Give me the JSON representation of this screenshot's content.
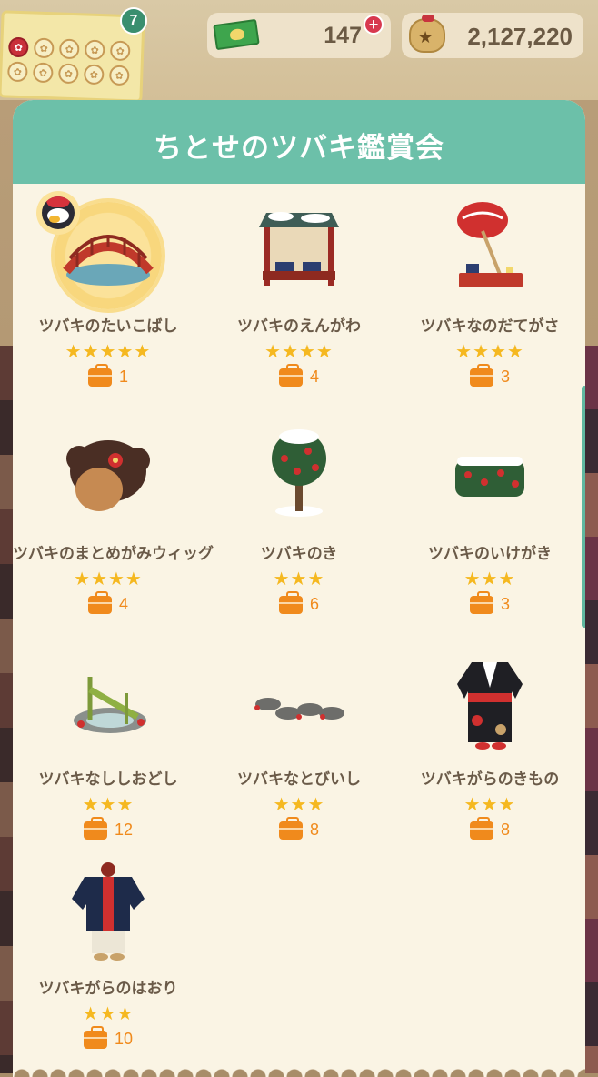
{
  "hud": {
    "stamp_badge": "7",
    "tickets": "147",
    "bells": "2,127,220"
  },
  "modal": {
    "title": "ちとせのツバキ鑑賞会"
  },
  "items": [
    {
      "name": "ツバキのたいこばし",
      "stars": "★★★★★",
      "count": "1",
      "icon": "drum-bridge-icon"
    },
    {
      "name": "ツバキのえんがわ",
      "stars": "★★★★",
      "count": "4",
      "icon": "veranda-icon"
    },
    {
      "name": "ツバキなのだてがさ",
      "stars": "★★★★",
      "count": "3",
      "icon": "parasol-icon"
    },
    {
      "name": "ツバキのまとめがみウィッグ",
      "stars": "★★★★",
      "count": "4",
      "icon": "wig-icon"
    },
    {
      "name": "ツバキのき",
      "stars": "★★★",
      "count": "6",
      "icon": "camellia-tree-icon"
    },
    {
      "name": "ツバキのいけがき",
      "stars": "★★★",
      "count": "3",
      "icon": "hedge-icon"
    },
    {
      "name": "ツバキなししおどし",
      "stars": "★★★",
      "count": "12",
      "icon": "shishi-odoshi-icon"
    },
    {
      "name": "ツバキなとびいし",
      "stars": "★★★",
      "count": "8",
      "icon": "stepping-stones-icon"
    },
    {
      "name": "ツバキがらのきもの",
      "stars": "★★★",
      "count": "8",
      "icon": "kimono-icon"
    },
    {
      "name": "ツバキがらのはおり",
      "stars": "★★★",
      "count": "10",
      "icon": "haori-icon"
    }
  ],
  "colors": {
    "header": "#6cc0a9",
    "panel": "#faf4e4",
    "star": "#f5b820",
    "count": "#f08a1c",
    "text": "#6a5a48"
  }
}
